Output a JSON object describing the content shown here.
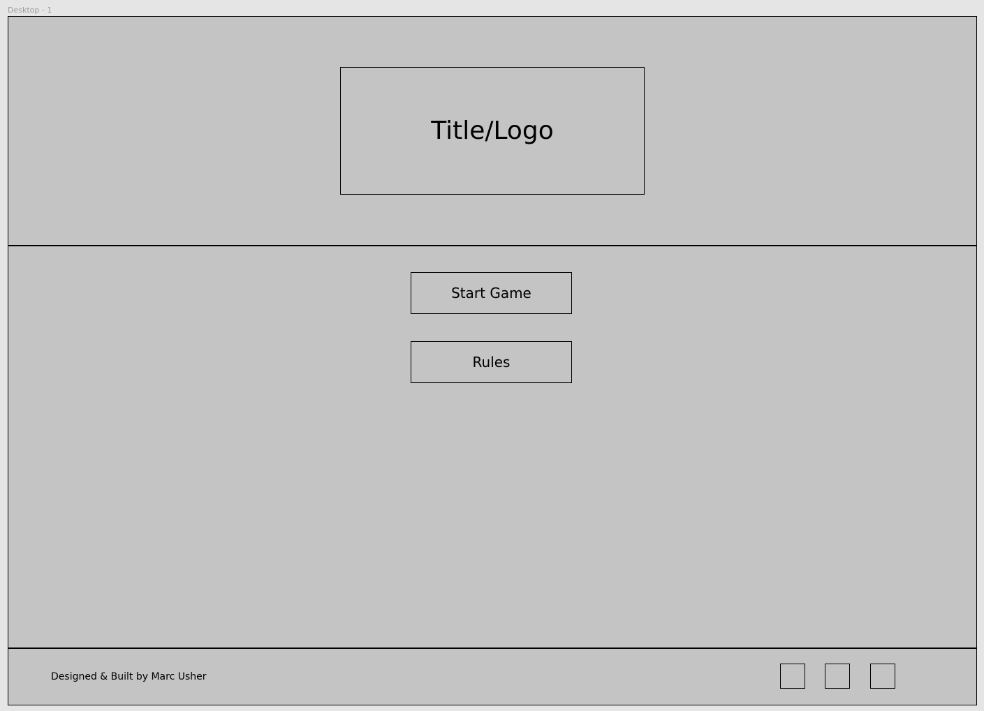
{
  "frame": {
    "label": "Desktop - 1"
  },
  "header": {
    "logo_text": "Title/Logo"
  },
  "main": {
    "start_label": "Start Game",
    "rules_label": "Rules"
  },
  "footer": {
    "credit": "Designed & Built by Marc Usher",
    "social_icons": [
      "social-placeholder-1",
      "social-placeholder-2",
      "social-placeholder-3"
    ]
  },
  "colors": {
    "canvas": "#e5e5e5",
    "frame_fill": "#c4c4c4",
    "stroke": "#000000"
  }
}
